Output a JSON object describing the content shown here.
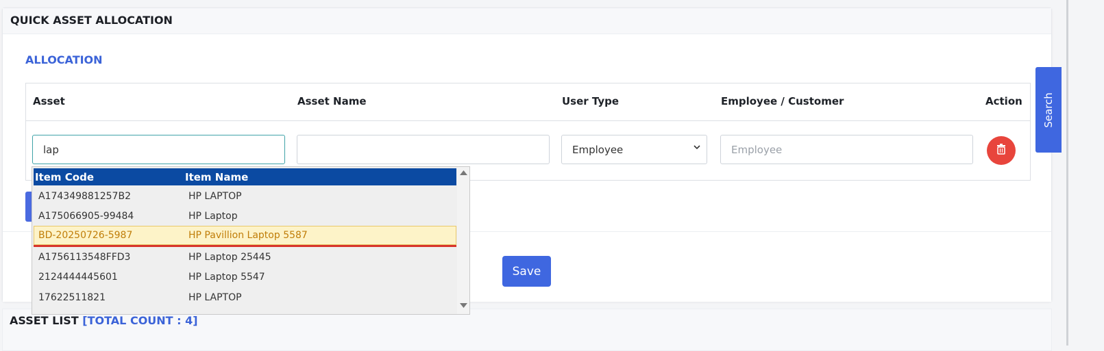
{
  "page": {
    "card_title": "QUICK ASSET ALLOCATION",
    "section_title": "ALLOCATION",
    "bottom_title": "ASSET LIST",
    "bottom_count": "[TOTAL COUNT : 4]"
  },
  "table": {
    "headers": {
      "asset": "Asset",
      "asset_name": "Asset Name",
      "user_type": "User Type",
      "employee_customer": "Employee / Customer",
      "action": "Action"
    },
    "row": {
      "asset_value": "lap",
      "asset_name_value": "",
      "user_type_selected": "Employee",
      "employee_placeholder": "Employee"
    }
  },
  "buttons": {
    "save": "Save",
    "search": "Search"
  },
  "dropdown": {
    "headers": {
      "code": "Item Code",
      "name": "Item Name"
    },
    "items": [
      {
        "code": "A174349881257B2",
        "name": "HP LAPTOP"
      },
      {
        "code": "A175066905-99484",
        "name": "HP Laptop"
      },
      {
        "code": "BD-20250726-5987",
        "name": "HP Pavillion Laptop 5587"
      },
      {
        "code": "A1756113548FFD3",
        "name": "HP Laptop 25445"
      },
      {
        "code": "2124444445601",
        "name": "HP Laptop 5547"
      },
      {
        "code": "17622511821",
        "name": "HP LAPTOP"
      }
    ],
    "selected_index": 2
  },
  "colors": {
    "accent": "#3f67e0",
    "section_title": "#3b63d8",
    "dropdown_header": "#0b4aa2",
    "delete": "#e8453c",
    "selected_row": "#fdf3c8",
    "selected_text": "#c07d08",
    "underline": "#d8342b"
  },
  "icons": {
    "delete": "trash-icon",
    "select": "chevron-down-icon",
    "scroll_up": "arrow-up-icon",
    "scroll_down": "arrow-down-icon"
  }
}
